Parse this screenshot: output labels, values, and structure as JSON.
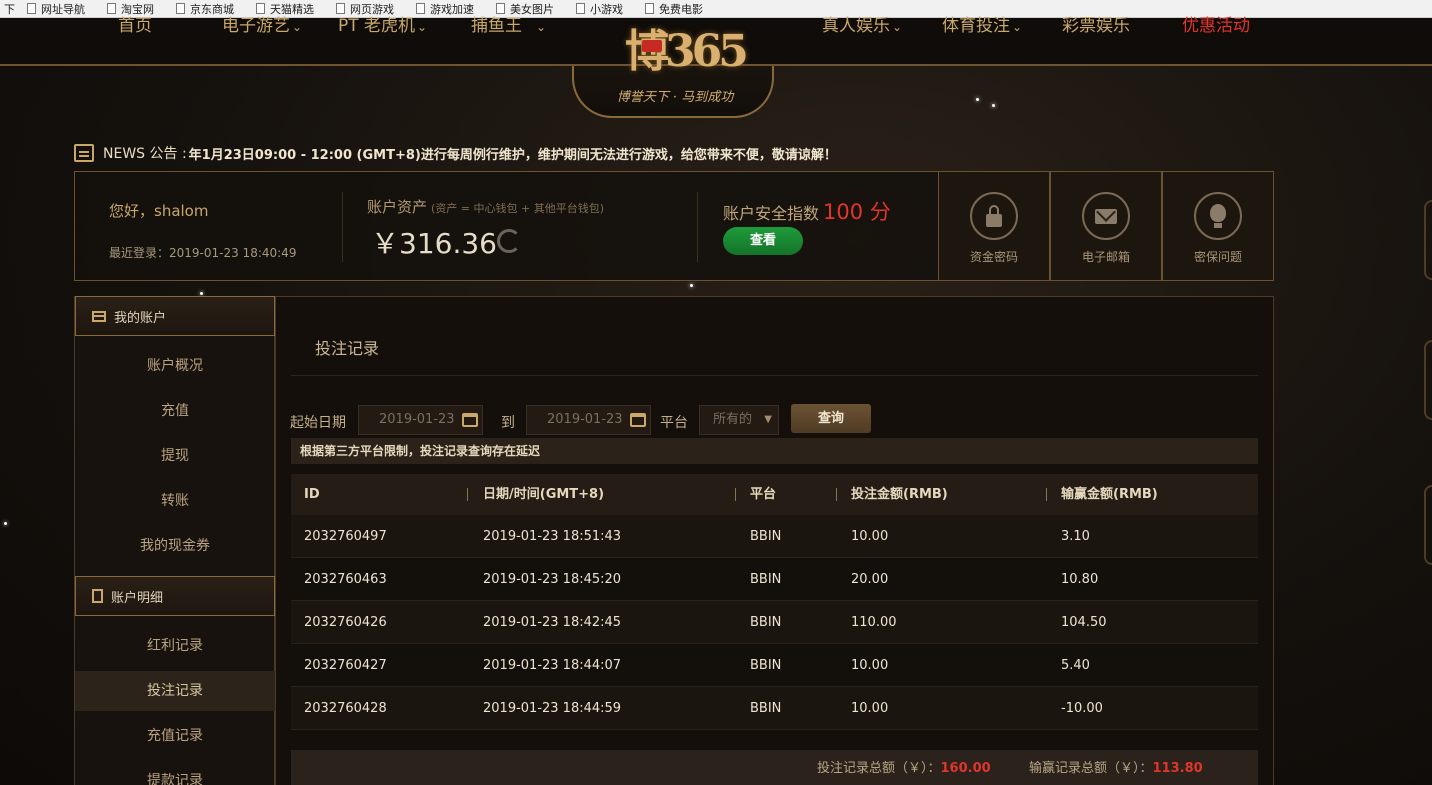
{
  "bookmarks": [
    "下",
    "网址导航",
    "淘宝网",
    "京东商城",
    "天猫精选",
    "网页游戏",
    "游戏加速",
    "美女图片",
    "小游戏",
    "免费电影"
  ],
  "nav": {
    "items": [
      {
        "label": "首页",
        "dropdown": false
      },
      {
        "label": "电子游艺",
        "dropdown": true
      },
      {
        "label": "PT 老虎机",
        "dropdown": true
      },
      {
        "label": "捕鱼王",
        "dropdown": true
      },
      {
        "label": "真人娱乐",
        "dropdown": true
      },
      {
        "label": "体育投注",
        "dropdown": true
      },
      {
        "label": "彩票娱乐",
        "dropdown": false
      },
      {
        "label": "优惠活动",
        "dropdown": false
      }
    ],
    "chevron": "⌄",
    "logo": {
      "brand": "博365",
      "slogan": "博誉天下 · 马到成功"
    }
  },
  "news": {
    "tag": "NEWS 公告 :",
    "text": "年1月23日09:00 - 12:00 (GMT+8)进行每周例行维护，维护期间无法进行游戏，给您带来不便，敬请谅解！"
  },
  "account": {
    "greeting": "您好，shalom",
    "last_login": "最近登录：2019-01-23 18:40:49",
    "asset_label": "账户资产",
    "asset_note": "(资产 = 中心钱包 + 其他平台钱包)",
    "asset_amount": "￥316.36",
    "safety_label": "账户安全指数",
    "safety_score": "100 分",
    "view_button": "查看",
    "security_items": [
      {
        "label": "资金密码",
        "icon": "lock-icon"
      },
      {
        "label": "电子邮箱",
        "icon": "mail-icon"
      },
      {
        "label": "密保问题",
        "icon": "bulb-icon"
      }
    ]
  },
  "sidebar": {
    "section1": "我的账户",
    "items1": [
      "账户概况",
      "充值",
      "提现",
      "转账",
      "我的现金券"
    ],
    "section2": "账户明细",
    "items2": [
      "红利记录",
      "投注记录",
      "充值记录",
      "提款记录"
    ],
    "active_item": "投注记录"
  },
  "main": {
    "title": "投注记录",
    "filter": {
      "start_label": "起始日期",
      "start_value": "2019-01-23",
      "to_label": "到",
      "end_value": "2019-01-23",
      "platform_label": "平台",
      "platform_value": "所有的",
      "query_button": "查询"
    },
    "notice": "根据第三方平台限制，投注记录查询存在延迟",
    "table": {
      "headers": [
        "ID",
        "日期/时间(GMT+8)",
        "平台",
        "投注金额(RMB)",
        "输赢金额(RMB)"
      ],
      "rows": [
        [
          "2032760497",
          "2019-01-23 18:51:43",
          "BBIN",
          "10.00",
          "3.10"
        ],
        [
          "2032760463",
          "2019-01-23 18:45:20",
          "BBIN",
          "20.00",
          "10.80"
        ],
        [
          "2032760426",
          "2019-01-23 18:42:45",
          "BBIN",
          "110.00",
          "104.50"
        ],
        [
          "2032760427",
          "2019-01-23 18:44:07",
          "BBIN",
          "10.00",
          "5.40"
        ],
        [
          "2032760428",
          "2019-01-23 18:44:59",
          "BBIN",
          "10.00",
          "-10.00"
        ]
      ]
    },
    "summary": {
      "bet_total_label": "投注记录总额（￥）：",
      "bet_total_value": "160.00",
      "win_total_label": "输赢记录总额（￥）：",
      "win_total_value": "113.80"
    }
  },
  "colors": {
    "accent_gold": "#c9a86a",
    "promo_red": "#e0352b",
    "view_green": "#1f9b3b"
  }
}
